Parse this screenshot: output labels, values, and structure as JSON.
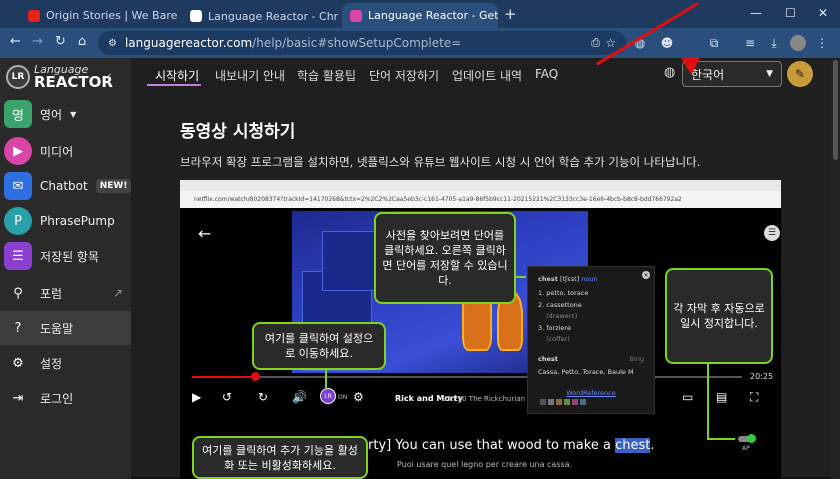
{
  "browser": {
    "tabs": [
      {
        "title": "Origin Stories | We Bare Bears",
        "favicon_color": "#e62117"
      },
      {
        "title": "Language Reactor - Chrome 웹",
        "favicon_color": "#ffffff"
      },
      {
        "title": "Language Reactor - Get Starte",
        "favicon_color": "#d946a8"
      }
    ],
    "new_tab_icon": "plus-icon",
    "window_controls": [
      "minimize-icon",
      "maximize-icon",
      "close-icon"
    ],
    "url_host": "languagereactor.com",
    "url_path": "/help/basic#showSetupComplete="
  },
  "app": {
    "logo_line1": "Language",
    "logo_line2": "REACTOR",
    "logo_badge": "LR",
    "sidebar": [
      {
        "label": "영어",
        "icon": "globe-icon",
        "icon_text": "영",
        "color": "#3aa36b",
        "dropdown": true
      },
      {
        "label": "미디어",
        "icon": "play-icon",
        "icon_text": "▶",
        "color": "#d946a8"
      },
      {
        "label": "Chatbot",
        "icon": "chat-icon",
        "icon_text": "💬",
        "color": "#2f6fe0",
        "badge": "NEW!"
      },
      {
        "label": "PhrasePump",
        "icon": "phrasepump-icon",
        "icon_text": "P",
        "color": "#2aa0a8"
      },
      {
        "label": "저장된 항목",
        "icon": "list-icon",
        "icon_text": "☰",
        "color": "#8a3fd0"
      },
      {
        "label": "포럼",
        "icon": "forum-icon",
        "icon_text": "🚶",
        "color": "#555555",
        "external": true
      },
      {
        "label": "도움말",
        "icon": "help-icon",
        "icon_text": "?",
        "color": "#555555",
        "selected": true
      },
      {
        "label": "설정",
        "icon": "gear-icon",
        "icon_text": "⚙",
        "color": "#555555"
      },
      {
        "label": "로그인",
        "icon": "login-icon",
        "icon_text": "⇥",
        "color": "#555555"
      }
    ],
    "nav_tabs": [
      "시작하기",
      "내보내기 안내",
      "학습 활용팁",
      "단어 저장하기",
      "업데이트 내역",
      "FAQ"
    ],
    "language_select": "한국어"
  },
  "content": {
    "heading": "동영상 시청하기",
    "paragraph": "브라우저 확장 프로그램을 설치하면, 넷플릭스와 유튜브 웹사이트 시청 시 언어 학습 추가 기능이 나타납니다."
  },
  "embedded": {
    "addr": "netflix.com/watch/80208374?trackId=14170268&tctx=2%2C2%2Caa5eb3c-c161-4705-a1a9-86f5b9cc11-20215221%2C3133cc3e-16e6-4bcb-b8c8-bdd766792a2",
    "time": "20:25",
    "ep_title": "Rick and Morty",
    "ep_sub": "S3:E10  The Rickchurian M",
    "lr_on": "ON",
    "subtitle_prefix": "rty] You can use that wood to make a",
    "subtitle_word": "chest",
    "subtitle_suffix": ".",
    "translation": "Puoi usare quel legno per creare una cassa.",
    "ap_label": "AP",
    "dict": {
      "word": "chest",
      "ipa": "[tʃɛst]",
      "pos": "noun",
      "defs": [
        "1. petto, torace",
        "2. cassettone",
        "(drawers)",
        "3. forziere",
        "(coffer)"
      ],
      "word2": "chest",
      "engine": "Bing",
      "translations": "Cassa, Petto, Torace, Baule M",
      "link": "WordReference"
    }
  },
  "callouts": {
    "c1": "사전을 찾아보려면 단어를 클릭하세요. 오른쪽 클릭하면 단어를 저장할 수 있습니다.",
    "c2": "여기를 클릭하여 설정으로 이동하세요.",
    "c3": "여기를 클릭하여 추가 기능을 활성화 또는 비활성화하세요.",
    "c4": "각 자막 후 자동으로 일시 정지합니다."
  },
  "colors": {
    "accent": "#7ed321",
    "arrow": "#e01010",
    "tab_underline": "#c080e0"
  }
}
